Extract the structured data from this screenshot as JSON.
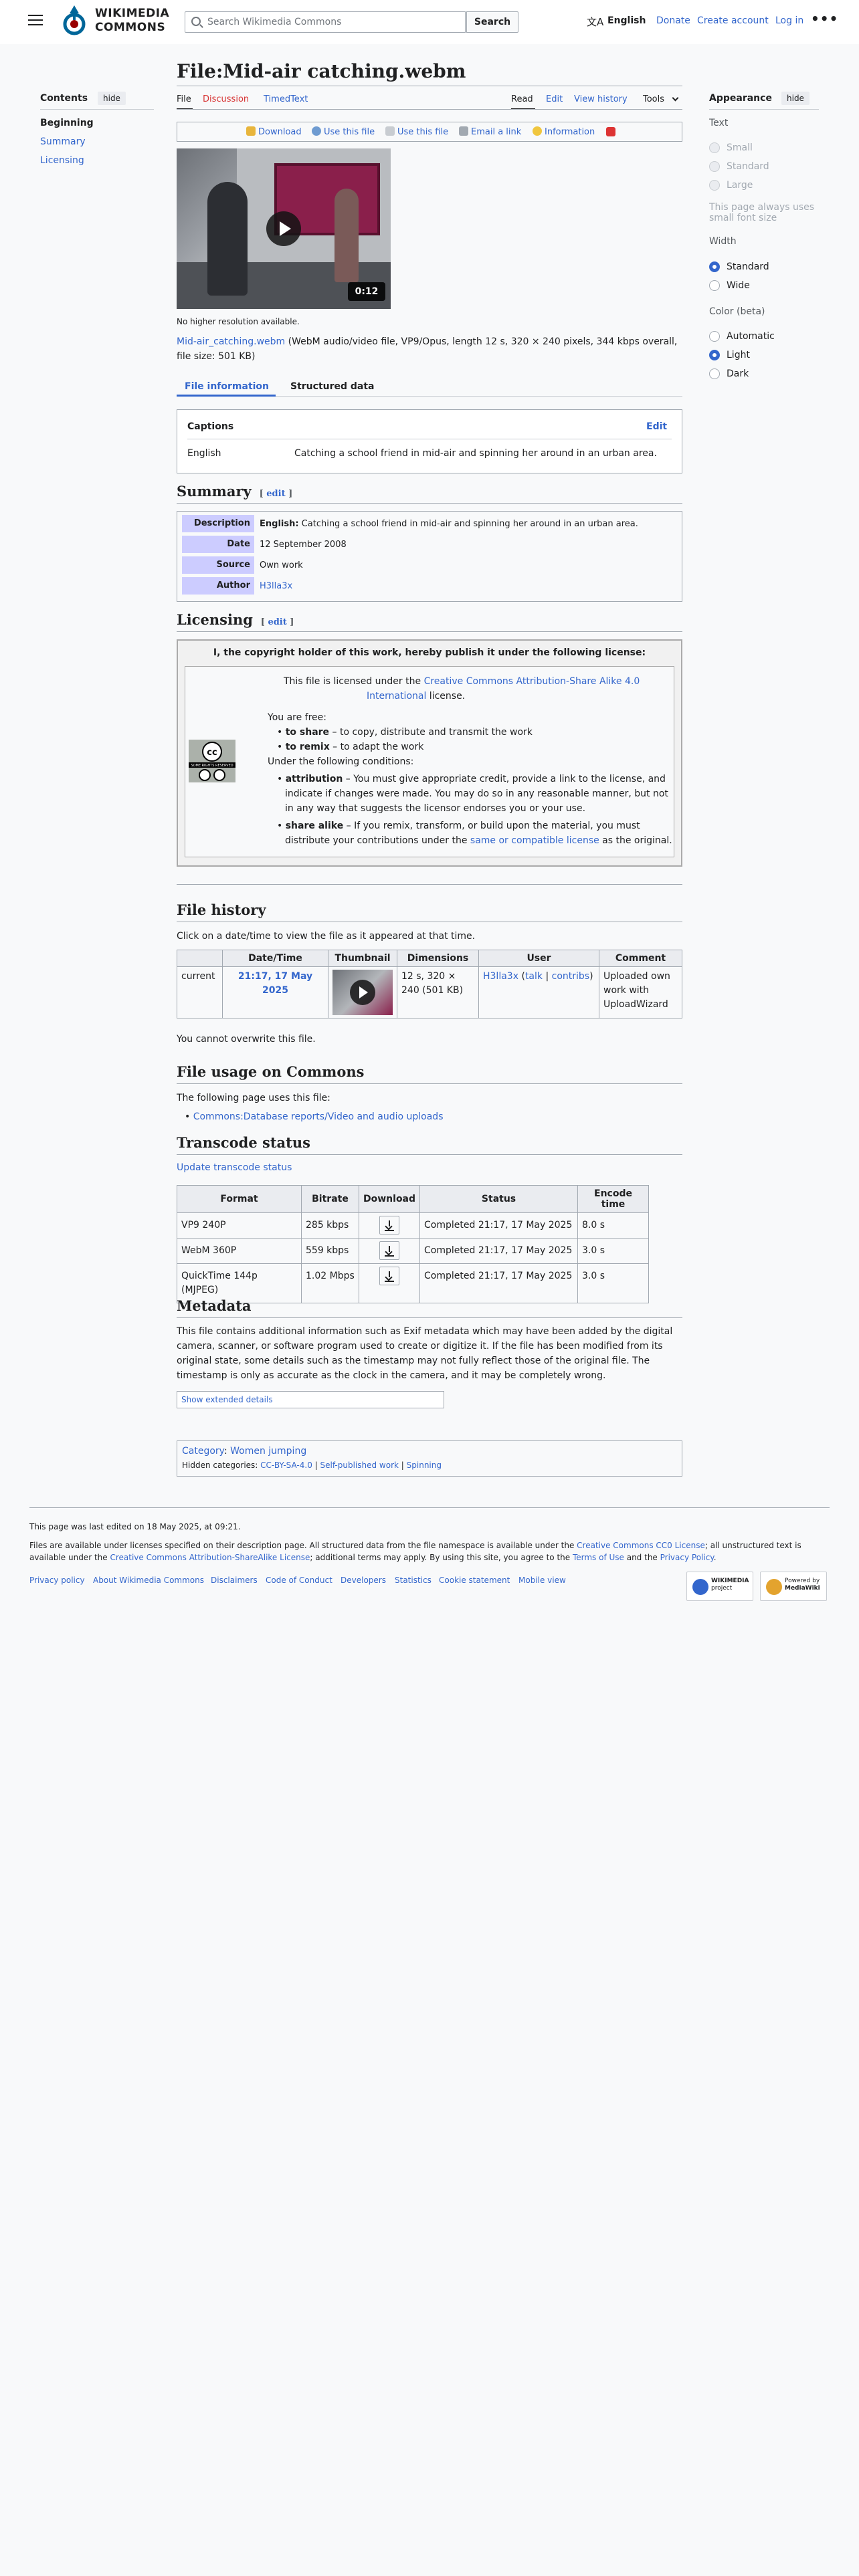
{
  "header": {
    "logo_line1": "WIKIMEDIA",
    "logo_line2": "COMMONS",
    "search_placeholder": "Search Wikimedia Commons",
    "search_button": "Search",
    "language": "English",
    "links": [
      "Donate",
      "Create account",
      "Log in"
    ],
    "more": "•••"
  },
  "toc": {
    "title": "Contents",
    "hide": "hide",
    "items": [
      "Beginning",
      "Summary",
      "Licensing"
    ]
  },
  "page": {
    "title": "File:Mid-air catching.webm",
    "tabs_left": [
      "File",
      "Discussion",
      "TimedText"
    ],
    "tabs_right": [
      "Read",
      "Edit",
      "View history",
      "Tools"
    ],
    "toolbar": [
      "Download",
      "Use this file",
      "Use this file",
      "Email a link",
      "Information"
    ],
    "video_duration": "0:12",
    "no_higher_res": "No higher resolution available.",
    "file_link": "Mid-air_catching.webm",
    "file_desc": " (WebM audio/video file, VP9/Opus, length 12 s, 320 × 240 pixels, 344 kbps overall, file size: 501 KB)",
    "subtabs": [
      "File information",
      "Structured data"
    ]
  },
  "captions": {
    "title": "Captions",
    "edit": "Edit",
    "lang": "English",
    "text": "Catching a school friend in mid-air and spinning her around in an urban area."
  },
  "summary": {
    "heading": "Summary",
    "edit": "edit",
    "rows": [
      {
        "label": "Description",
        "lang": "English:",
        "value": " Catching a school friend in mid-air and spinning her around in an urban area."
      },
      {
        "label": "Date",
        "value": "12 September 2008"
      },
      {
        "label": "Source",
        "value": "Own work"
      },
      {
        "label": "Author",
        "value": "H3lla3x"
      }
    ]
  },
  "licensing": {
    "heading": "Licensing",
    "edit": "edit",
    "header": "I, the copyright holder of this work, hereby publish it under the following license:",
    "intro_pre": "This file is licensed under the ",
    "license_name_1": "Creative Commons Attribution-Share Alike 4.0",
    "license_name_2": "International",
    "intro_post": " license.",
    "free_title": "You are free:",
    "free": [
      {
        "term": "to share",
        "text": " – to copy, distribute and transmit the work"
      },
      {
        "term": "to remix",
        "text": " – to adapt the work"
      }
    ],
    "cond_title": "Under the following conditions:",
    "attr_term": "attribution",
    "attr_1": " – You must give appropriate credit, provide a link to the license, and",
    "attr_2": "indicate if changes were made. You may do so in any reasonable manner, but not",
    "attr_3": "in any way that suggests the licensor endorses you or your use.",
    "sa_term": "share alike",
    "sa_1": " – If you remix, transform, or build upon the material, you must",
    "sa_2_pre": "distribute your contributions under the ",
    "sa_2_link": "same or compatible license",
    "sa_2_post": " as the original.",
    "cc_badge": "SOME RIGHTS RESERVED"
  },
  "history": {
    "heading": "File history",
    "intro": "Click on a date/time to view the file as it appeared at that time.",
    "columns": [
      "",
      "Date/Time",
      "Thumbnail",
      "Dimensions",
      "User",
      "Comment"
    ],
    "row": {
      "status": "current",
      "datetime": "21:17, 17 May 2025",
      "dim_1": "12 s, 320 ×",
      "dim_2": "240 (501 KB)",
      "user": "H3lla3x",
      "talk": "talk",
      "contribs": "contribs",
      "comment_1": "Uploaded own",
      "comment_2": "work with",
      "comment_3": "UploadWizard"
    },
    "overwrite": "You cannot overwrite this file."
  },
  "usage": {
    "heading": "File usage on Commons",
    "intro": "The following page uses this file:",
    "link": "Commons:Database reports/Video and audio uploads"
  },
  "transcode": {
    "heading": "Transcode status",
    "update": "Update transcode status",
    "columns": [
      "Format",
      "Bitrate",
      "Download",
      "Status",
      "Encode time"
    ],
    "rows": [
      {
        "format": "VP9 240P",
        "bitrate": "285 kbps",
        "status": "Completed 21:17, 17 May 2025",
        "time": "8.0 s"
      },
      {
        "format": "WebM 360P",
        "bitrate": "559 kbps",
        "status": "Completed 21:17, 17 May 2025",
        "time": "3.0 s"
      },
      {
        "format": "QuickTime 144p (MJPEG)",
        "bitrate": "1.02 Mbps",
        "status": "Completed 21:17, 17 May 2025",
        "time": "3.0 s"
      }
    ]
  },
  "metadata": {
    "heading": "Metadata",
    "line1": "This file contains additional information such as Exif metadata which may have been added by the digital",
    "line2": "camera, scanner, or software program used to create or digitize it. If the file has been modified from its",
    "line3": "original state, some details such as the timestamp may not fully reflect those of the original file. The",
    "line4": "timestamp is only as accurate as the clock in the camera, and it may be completely wrong.",
    "show_extended": "Show extended details"
  },
  "categories": {
    "label": "Category",
    "category": "Women jumping",
    "hidden_label": "Hidden categories:",
    "hidden": [
      "CC-BY-SA-4.0",
      "Self-published work",
      "Spinning"
    ]
  },
  "appearance": {
    "title": "Appearance",
    "hide": "hide",
    "text_label": "Text",
    "text_options": [
      "Small",
      "Standard",
      "Large"
    ],
    "text_note_1": "This page always uses",
    "text_note_2": "small font size",
    "width_label": "Width",
    "width_options": [
      "Standard",
      "Wide"
    ],
    "color_label": "Color (beta)",
    "color_options": [
      "Automatic",
      "Light",
      "Dark"
    ]
  },
  "footer": {
    "last_edited": "This page was last edited on 18 May 2025, at 09:21.",
    "lic_1_pre": "Files are available under licenses specified on their description page. All structured data from the file namespace is available under the ",
    "lic_1_link": "Creative Commons CC0 License",
    "lic_1_post": "; all unstructured text is",
    "lic_2_pre": "available under the ",
    "lic_2_link": "Creative Commons Attribution-ShareAlike License",
    "lic_2_mid": "; additional terms may apply. By using this site, you agree to the ",
    "lic_2_terms": "Terms of Use",
    "lic_2_and": " and the ",
    "lic_2_privacy": "Privacy Policy",
    "lic_2_end": ".",
    "links": [
      "Privacy policy",
      "About Wikimedia Commons",
      "Disclaimers",
      "Code of Conduct",
      "Developers",
      "Statistics",
      "Cookie statement",
      "Mobile view"
    ],
    "badge1_1": "WIKIMEDIA",
    "badge1_2": "project",
    "badge2_1": "Powered by",
    "badge2_2": "MediaWiki"
  },
  "colors": {
    "link": "#3366cc",
    "summary_label_bg": "#ccccff",
    "page_bg": "#f8f9fa"
  }
}
